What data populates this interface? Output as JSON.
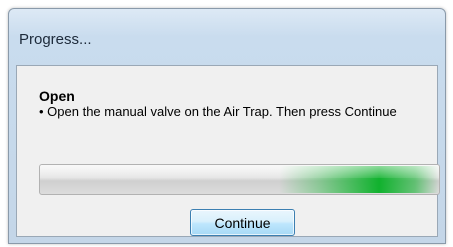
{
  "window": {
    "title": "Progress..."
  },
  "content": {
    "heading": "Open",
    "message": "• Open the manual valve on the Air Trap. Then press Continue"
  },
  "buttons": {
    "continue_label": "Continue"
  },
  "colors": {
    "progress_accent": "#06b025",
    "button_border": "#3c7fb1",
    "client_background": "#f0f0f0"
  }
}
